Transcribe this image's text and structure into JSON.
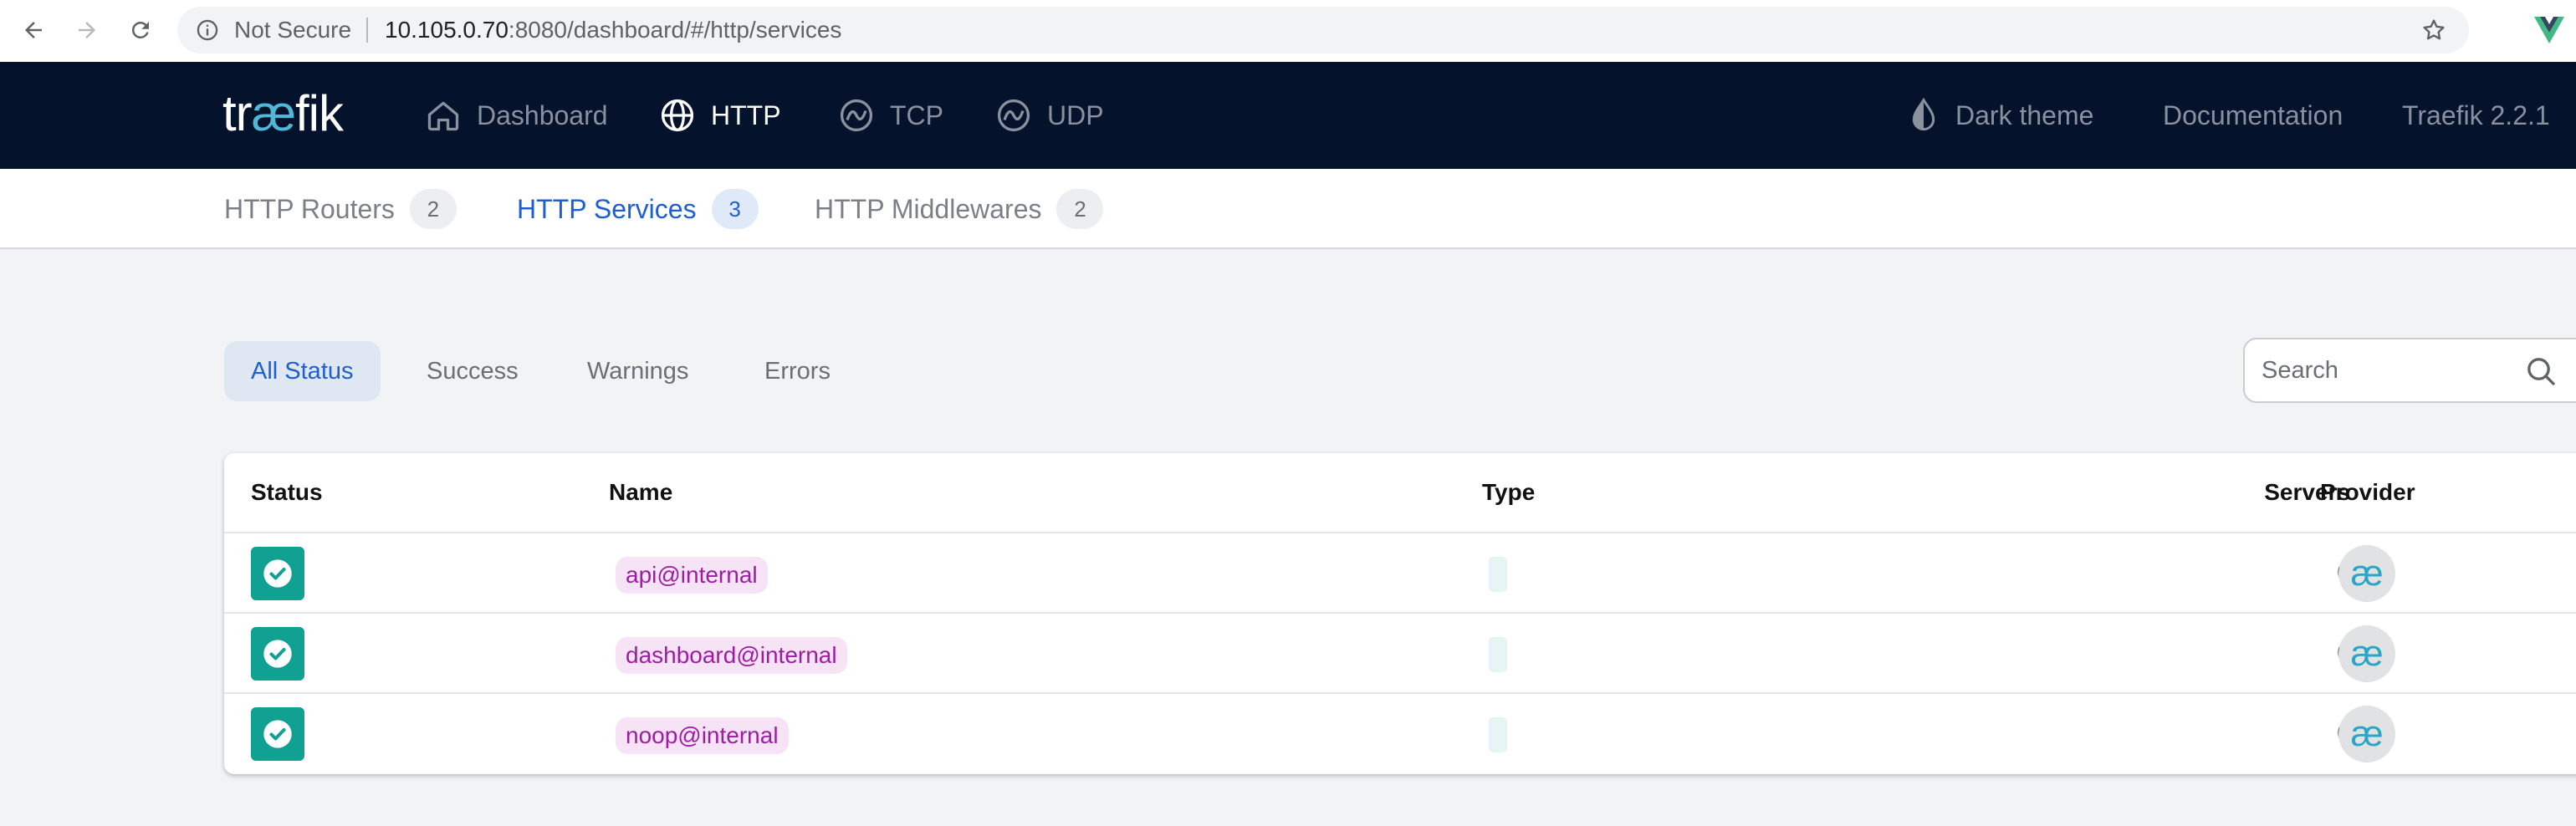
{
  "browser": {
    "security_label": "Not Secure",
    "url_host": "10.105.0.70",
    "url_rest": ":8080/dashboard/#/http/services"
  },
  "header": {
    "logo_prefix": "tr",
    "logo_ae": "æ",
    "logo_suffix": "fik",
    "nav": [
      {
        "label": "Dashboard",
        "icon": "home-icon"
      },
      {
        "label": "HTTP",
        "icon": "globe-icon"
      },
      {
        "label": "TCP",
        "icon": "tcp-icon"
      },
      {
        "label": "UDP",
        "icon": "udp-icon"
      }
    ],
    "dark_theme_label": "Dark theme",
    "documentation_label": "Documentation",
    "version_label": "Traefik 2.2.1"
  },
  "subnav": {
    "tabs": [
      {
        "label": "HTTP Routers",
        "count": "2"
      },
      {
        "label": "HTTP Services",
        "count": "3"
      },
      {
        "label": "HTTP Middlewares",
        "count": "2"
      }
    ]
  },
  "filters": {
    "options": [
      "All Status",
      "Success",
      "Warnings",
      "Errors"
    ],
    "selected": "All Status",
    "search_placeholder": "Search"
  },
  "table": {
    "columns": [
      "Status",
      "Name",
      "Type",
      "Servers",
      "Provider"
    ],
    "rows": [
      {
        "status": "success",
        "name": "api@internal",
        "servers": "0",
        "provider_icon": "æ"
      },
      {
        "status": "success",
        "name": "dashboard@internal",
        "servers": "0",
        "provider_icon": "æ"
      },
      {
        "status": "success",
        "name": "noop@internal",
        "servers": "0",
        "provider_icon": "æ"
      }
    ]
  },
  "colors": {
    "header_bg": "#05122c",
    "accent_blue": "#1d5fd3",
    "success_green": "#11a192",
    "name_chip_text": "#a11aa6",
    "logo_ae": "#4fb8d8"
  }
}
